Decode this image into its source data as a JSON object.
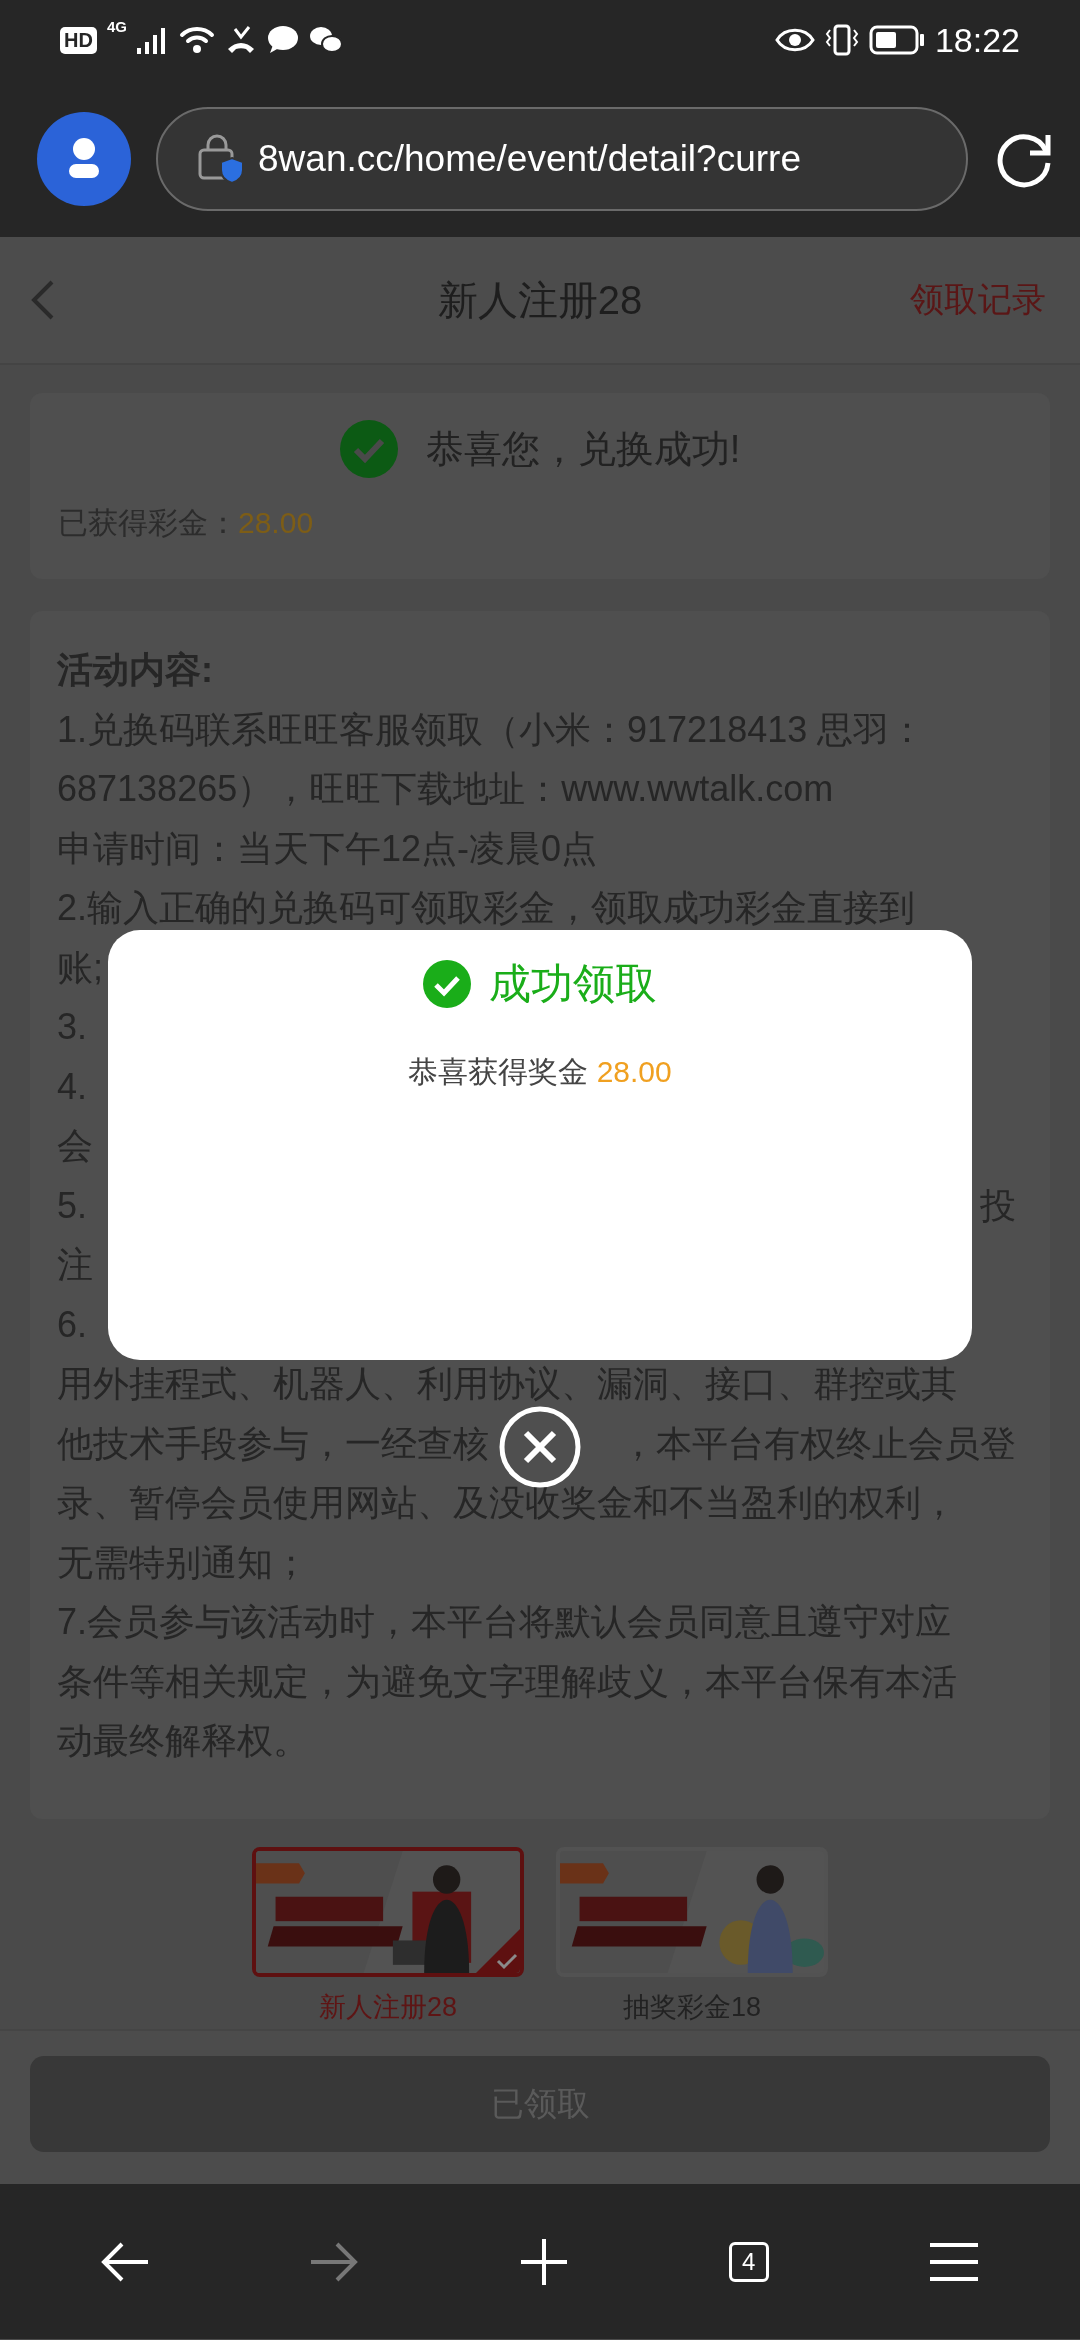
{
  "status_bar": {
    "network_labels": [
      "HD",
      "4G"
    ],
    "time": "18:22"
  },
  "browser_bar": {
    "url": "8wan.cc/home/event/detail?curre"
  },
  "header": {
    "title": "新人注册28",
    "action": "领取记录"
  },
  "result_card": {
    "title": "恭喜您，兑换成功!",
    "label": "已获得彩金：",
    "amount": "28.00"
  },
  "rules": {
    "heading": "活动内容:",
    "lines": [
      {
        "text": "1.兑换码联系旺旺客服领取（小米：917218413 思羽："
      },
      {
        "text": "687138265），旺旺下载地址：www.wwtalk.com"
      },
      {
        "text": "申请时间：当天下午12点-凌晨0点"
      },
      {
        "text": "2.输入正确的兑换码可领取彩金，领取成功彩金直接到"
      },
      {
        "text": "账;"
      },
      {
        "text": "3."
      },
      {
        "text": "4."
      },
      {
        "text": "会"
      },
      {
        "text": "5.",
        "right_text": "投"
      },
      {
        "text": "注"
      },
      {
        "text": "6."
      },
      {
        "text": "用外挂程式、机器人、利用协议、漏洞、接口、群控或其"
      },
      {
        "text": "他技术手段参与，一经查核",
        "right_text": "，本平台有权终止会员登"
      },
      {
        "text": "录、暂停会员使用网站、及没收奖金和不当盈利的权利，"
      },
      {
        "text": "无需特别通知；"
      },
      {
        "text": "7.会员参与该活动时，本平台将默认会员同意且遵守对应"
      },
      {
        "text": "条件等相关规定，为避免文字理解歧义，本平台保有本活"
      },
      {
        "text": "动最终解释权。"
      }
    ]
  },
  "activities": [
    {
      "label": "新人注册28",
      "selected": true
    },
    {
      "label": "抽奖彩金18",
      "selected": false
    }
  ],
  "claim_button": {
    "label": "已领取",
    "disabled": true
  },
  "dialog": {
    "title": "成功领取",
    "message": "恭喜获得奖金",
    "amount": "28.00"
  },
  "browser_nav": {
    "back_disabled": false,
    "forward_disabled": true,
    "tab_count": "4"
  }
}
